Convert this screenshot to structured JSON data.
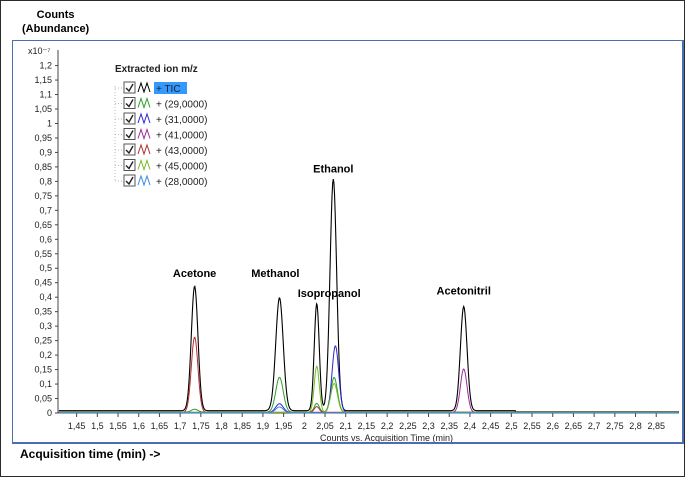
{
  "window": {
    "y_axis_title_line1": "Counts",
    "y_axis_title_line2": "(Abundance)",
    "bottom_label": "Acquisition time (min) ->"
  },
  "legend": {
    "title": "Extracted ion m/z",
    "items": [
      {
        "label": "+ TIC",
        "color": "#000000",
        "checked": true,
        "selected": true
      },
      {
        "label": "+ (29,0000)",
        "color": "#2aa02a",
        "checked": true
      },
      {
        "label": "+ (31,0000)",
        "color": "#2a2ad0",
        "checked": true
      },
      {
        "label": "+ (41,0000)",
        "color": "#9a2aa0",
        "checked": true
      },
      {
        "label": "+ (43,0000)",
        "color": "#b03030",
        "checked": true
      },
      {
        "label": "+ (45,0000)",
        "color": "#70c020",
        "checked": true
      },
      {
        "label": "+ (28,0000)",
        "color": "#3a8ae0",
        "checked": true
      }
    ]
  },
  "chart_data": {
    "type": "line",
    "xlabel": "Counts vs. Acquisition Time (min)",
    "multiplier_label": "x10⁻⁷",
    "xlim": [
      1.405,
      2.905
    ],
    "ylim": [
      0,
      1.24
    ],
    "x_ticks": [
      "1,45",
      "1,5",
      "1,55",
      "1,6",
      "1,65",
      "1,7",
      "1,75",
      "1,8",
      "1,85",
      "1,9",
      "1,95",
      "2",
      "2,05",
      "2,1",
      "2,15",
      "2,2",
      "2,25",
      "2,3",
      "2,35",
      "2,4",
      "2,45",
      "2,5",
      "2,55",
      "2,6",
      "2,65",
      "2,7",
      "2,75",
      "2,8",
      "2,85"
    ],
    "y_ticks": [
      "0",
      "0,05",
      "0,1",
      "0,15",
      "0,2",
      "0,25",
      "0,3",
      "0,35",
      "0,4",
      "0,45",
      "0,5",
      "0,55",
      "0,6",
      "0,65",
      "0,7",
      "0,75",
      "0,8",
      "0,85",
      "0,9",
      "0,95",
      "1",
      "1,05",
      "1,1",
      "1,15",
      "1,2"
    ],
    "series": [
      {
        "name": "+ TIC",
        "color": "#000000",
        "baseline": 0.008,
        "peaks": [
          [
            1.735,
            0.43,
            0.008
          ],
          [
            1.94,
            0.39,
            0.009
          ],
          [
            2.03,
            0.37,
            0.006
          ],
          [
            2.07,
            0.8,
            0.008
          ],
          [
            2.385,
            0.36,
            0.008
          ]
        ]
      },
      {
        "name": "+ (29,0000)",
        "color": "#2aa02a",
        "baseline": 0.003,
        "peaks": [
          [
            1.735,
            0.01,
            0.008
          ],
          [
            1.94,
            0.12,
            0.009
          ],
          [
            2.03,
            0.03,
            0.006
          ],
          [
            2.072,
            0.12,
            0.008
          ]
        ]
      },
      {
        "name": "+ (31,0000)",
        "color": "#2a2ad0",
        "baseline": 0.002,
        "peaks": [
          [
            1.94,
            0.03,
            0.009
          ],
          [
            2.075,
            0.23,
            0.008
          ]
        ]
      },
      {
        "name": "+ (41,0000)",
        "color": "#9a2aa0",
        "baseline": 0.002,
        "peaks": [
          [
            2.385,
            0.15,
            0.008
          ]
        ]
      },
      {
        "name": "+ (43,0000)",
        "color": "#b03030",
        "baseline": 0.002,
        "peaks": [
          [
            1.735,
            0.26,
            0.008
          ],
          [
            2.03,
            0.02,
            0.006
          ]
        ]
      },
      {
        "name": "+ (45,0000)",
        "color": "#70c020",
        "baseline": 0.002,
        "peaks": [
          [
            2.03,
            0.16,
            0.006
          ],
          [
            2.072,
            0.1,
            0.008
          ]
        ]
      },
      {
        "name": "+ (28,0000)",
        "color": "#3a8ae0",
        "baseline": 0.001,
        "peaks": [
          [
            1.94,
            0.02,
            0.009
          ]
        ]
      }
    ],
    "annotations": [
      {
        "text": "Acetone",
        "x": 1.735,
        "y": 0.47
      },
      {
        "text": "Methanol",
        "x": 1.93,
        "y": 0.47
      },
      {
        "text": "Isopropanol",
        "x": 2.06,
        "y": 0.4
      },
      {
        "text": "Ethanol",
        "x": 2.07,
        "y": 0.83
      },
      {
        "text": "Acetonitril",
        "x": 2.385,
        "y": 0.41
      }
    ]
  }
}
